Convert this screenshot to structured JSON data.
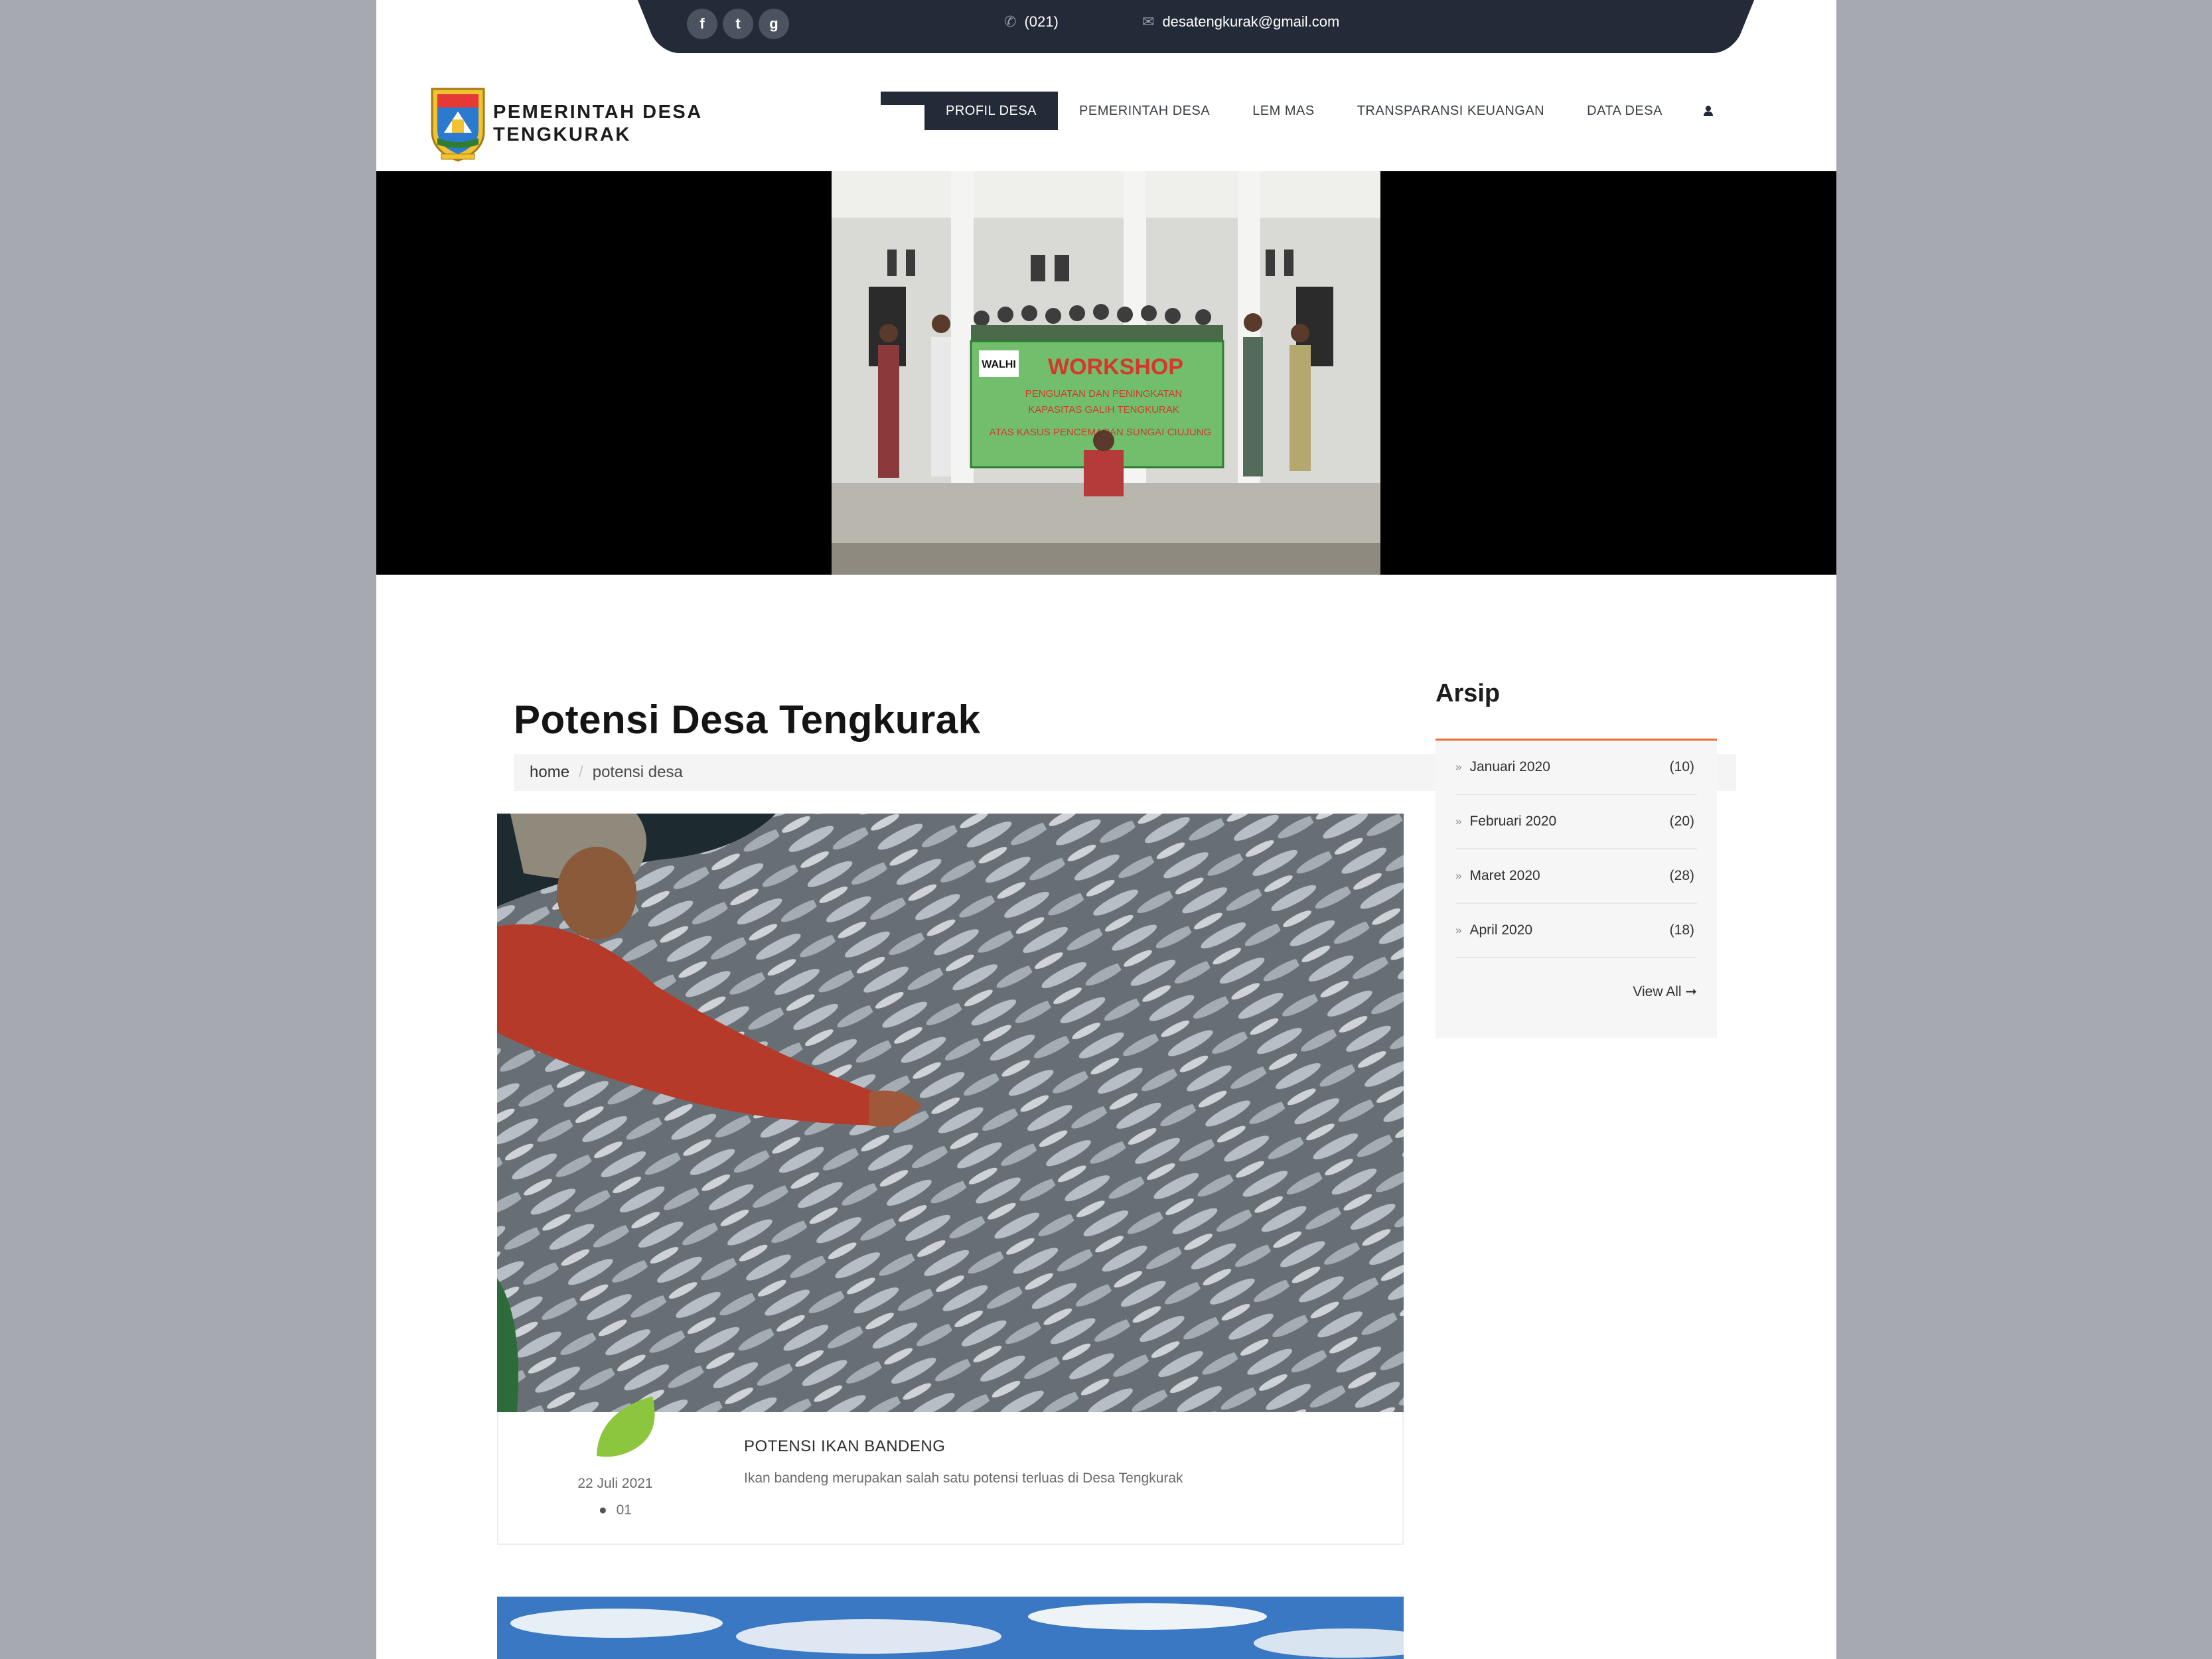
{
  "topbar": {
    "social": [
      {
        "icon": "facebook-icon",
        "glyph": "f"
      },
      {
        "icon": "twitter-icon",
        "glyph": "t"
      },
      {
        "icon": "google-plus-icon",
        "glyph": "g"
      }
    ],
    "phone": "(021)",
    "email": "desatengkurak@gmail.com"
  },
  "header": {
    "brand_line1": "PEMERINTAH DESA",
    "brand_line2": "TENGKURAK",
    "nav": [
      {
        "label": "PROFIL DESA",
        "active": true
      },
      {
        "label": "PEMERINTAH DESA",
        "active": false
      },
      {
        "label": "LEM MAS",
        "active": false
      },
      {
        "label": "TRANSPARANSI KEUANGAN",
        "active": false
      },
      {
        "label": "DATA DESA",
        "active": false
      }
    ]
  },
  "hero": {
    "banner_brand": "WALHI",
    "banner_title": "WORKSHOP",
    "banner_line1": "PENGUATAN DAN PENINGKATAN",
    "banner_line2": "KAPASITAS GALIH TENGKURAK",
    "banner_line3": "ATAS KASUS PENCEMARAN SUNGAI CIUJUNG"
  },
  "main": {
    "page_title": "Potensi Desa Tengkurak",
    "breadcrumb": {
      "home": "home",
      "current": "potensi desa"
    },
    "posts": [
      {
        "title": "POTENSI IKAN BANDENG",
        "excerpt": "Ikan bandeng merupakan salah satu potensi terluas di Desa Tengkurak",
        "date": "22 Juli 2021",
        "comments": "01"
      }
    ]
  },
  "sidebar": {
    "title": "Arsip",
    "items": [
      {
        "label": "Januari 2020",
        "count": "(10)"
      },
      {
        "label": "Februari 2020",
        "count": "(20)"
      },
      {
        "label": "Maret 2020",
        "count": "(28)"
      },
      {
        "label": "April 2020",
        "count": "(18)"
      }
    ],
    "view_all": "View All"
  },
  "colors": {
    "dark": "#232a38",
    "accent": "#f06b32",
    "leaf": "#8cc63f"
  }
}
